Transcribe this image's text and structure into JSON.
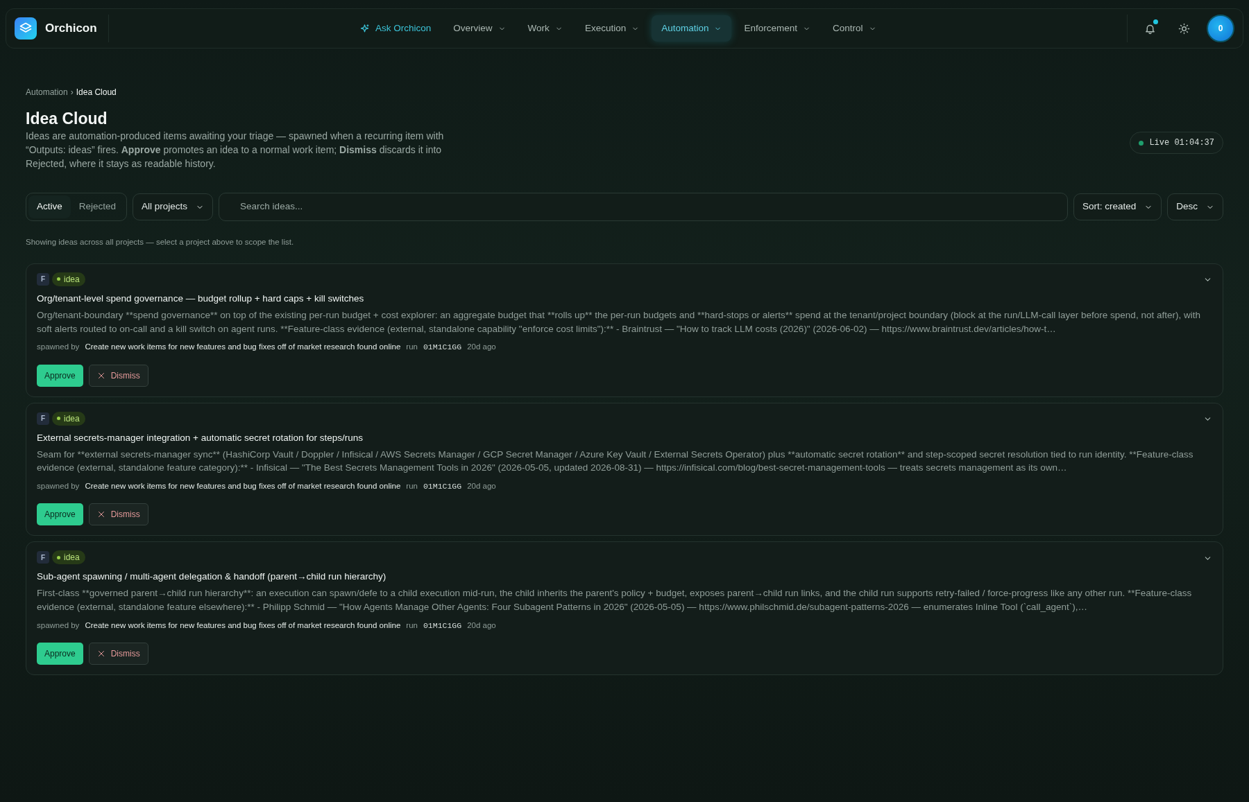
{
  "brand": {
    "name": "Orchicon"
  },
  "nav": [
    {
      "label": "Ask Orchicon",
      "kind": "ask",
      "selected": false
    },
    {
      "label": "Overview",
      "kind": "menu",
      "selected": false
    },
    {
      "label": "Work",
      "kind": "menu",
      "selected": false
    },
    {
      "label": "Execution",
      "kind": "menu",
      "selected": false
    },
    {
      "label": "Automation",
      "kind": "menu",
      "selected": true
    },
    {
      "label": "Enforcement",
      "kind": "menu",
      "selected": false
    },
    {
      "label": "Control",
      "kind": "menu",
      "selected": false
    }
  ],
  "notifications": {
    "unread": true
  },
  "avatar": {
    "label": "0"
  },
  "breadcrumb_separator": "›",
  "breadcrumb": [
    {
      "label": "Automation",
      "selected": false
    },
    {
      "label": "Idea Cloud",
      "selected": true
    }
  ],
  "page": {
    "title": "Idea Cloud",
    "intro": "Ideas are automation-produced items awaiting your triage — spawned when a recurring item with “Outputs: ideas” fires. **Approve** promotes an idea to a normal work item; **Dismiss** discards it into Rejected, where it stays as readable history."
  },
  "live": {
    "label": "Live 01:04:37"
  },
  "filters": {
    "tabs": [
      {
        "label": "Active",
        "selected": true
      },
      {
        "label": "Rejected",
        "selected": false
      }
    ],
    "project": "All projects",
    "search_placeholder": "Search ideas...",
    "sort": "Sort: created",
    "order": "Desc"
  },
  "scope_note": "Showing ideas across all projects — select a project above to scope the list.",
  "ideas": [
    {
      "letter": "F",
      "tag": "idea",
      "title": "Org/tenant-level spend governance — budget rollup + hard caps + kill switches",
      "description": "Org/tenant-boundary **spend governance** on top of the existing per-run budget + cost explorer: an aggregate budget that **rolls up** the per-run budgets and **hard-stops or alerts** spend at the tenant/project boundary (block at the run/LLM-call layer before spend, not after), with soft alerts routed to on-call and a kill switch on agent runs. **Feature-class evidence (external, standalone capability \"enforce cost limits\"):** - Braintrust — \"How to track LLM costs (2026)\" (2026-06-02) — https://www.braintrust.dev/articles/how-t…",
      "spawned_label": "spawned by",
      "source": "Create new work items for new features and bug fixes off of market research found online",
      "run_label": "run",
      "run_id": "01M1C1GG",
      "age": "20d ago",
      "approve": "Approve",
      "dismiss": "Dismiss"
    },
    {
      "letter": "F",
      "tag": "idea",
      "title": "External secrets-manager integration + automatic secret rotation for steps/runs",
      "description": "Seam for **external secrets-manager sync** (HashiCorp Vault / Doppler / Infisical / AWS Secrets Manager / GCP Secret Manager / Azure Key Vault / External Secrets Operator) plus **automatic secret rotation** and step-scoped secret resolution tied to run identity. **Feature-class evidence (external, standalone feature category):** - Infisical — \"The Best Secrets Management Tools in 2026\" (2026-05-05, updated 2026-08-31) — https://infisical.com/blog/best-secret-management-tools — treats secrets management as its own…",
      "spawned_label": "spawned by",
      "source": "Create new work items for new features and bug fixes off of market research found online",
      "run_label": "run",
      "run_id": "01M1C1GG",
      "age": "20d ago",
      "approve": "Approve",
      "dismiss": "Dismiss"
    },
    {
      "letter": "F",
      "tag": "idea",
      "title": "Sub-agent spawning / multi-agent delegation & handoff (parent→child run hierarchy)",
      "description": "First-class **governed parent→child run hierarchy**: an execution can spawn/defe to a child execution mid-run, the child inherits the parent's policy + budget, exposes parent→child run links, and the child run supports retry-failed / force-progress like any other run. **Feature-class evidence (external, standalone feature elsewhere):** - Philipp Schmid — \"How Agents Manage Other Agents: Four Subagent Patterns in 2026\" (2026-05-05) — https://www.philschmid.de/subagent-patterns-2026 — enumerates Inline Tool (`call_agent`),…",
      "spawned_label": "spawned by",
      "source": "Create new work items for new features and bug fixes off of market research found online",
      "run_label": "run",
      "run_id": "01M1C1GG",
      "age": "20d ago",
      "approve": "Approve",
      "dismiss": "Dismiss"
    }
  ]
}
